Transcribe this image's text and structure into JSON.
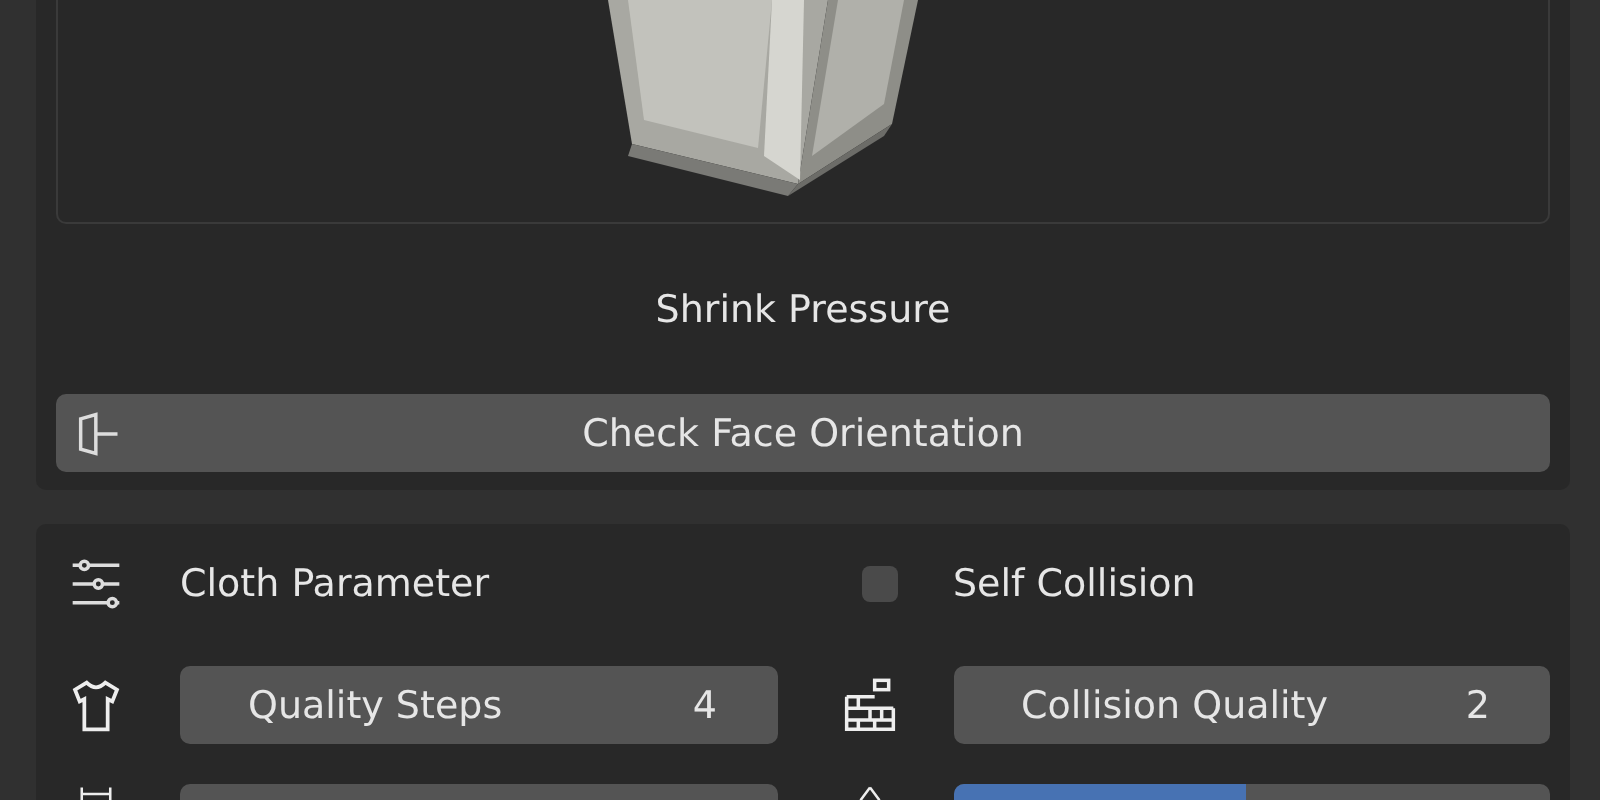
{
  "preview": {
    "kind": "picture",
    "caption": "Shrink Pressure"
  },
  "check_button": {
    "label": "Check Face Orientation"
  },
  "cloth_panel": {
    "title": "Cloth Parameter",
    "self_collision": {
      "label": "Self Collision",
      "checked": false
    },
    "fields": [
      {
        "kind": "number",
        "label": "Quality Steps",
        "value": "4"
      },
      {
        "kind": "number",
        "label": "Collision Quality",
        "value": "2"
      },
      {
        "kind": "number"
      },
      {
        "kind": "slider",
        "level": 0.49
      }
    ]
  }
}
